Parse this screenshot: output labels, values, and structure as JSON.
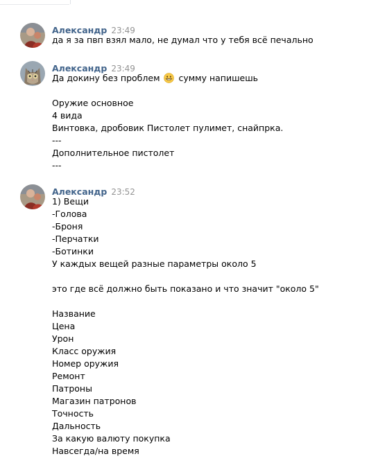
{
  "messages": [
    {
      "author": "Александр",
      "time": "23:49",
      "lines": [
        "да я за пвп взял мало, не думал что у тебя всё печально"
      ]
    },
    {
      "author": "Александр",
      "time": "23:49",
      "first_line": {
        "before": "Да докину без проблем",
        "emoji": "grinning-face-emoji",
        "after": "сумму напишешь"
      },
      "lines": [
        "",
        "Оружие основное",
        "4 вида",
        "Винтовка, дробовик Пистолет пулимет, снайпрка.",
        "---",
        "Дополнительное пистолет",
        "---"
      ]
    },
    {
      "author": "Александр",
      "time": "23:52",
      "lines": [
        "1) Вещи",
        "-Голова",
        "-Броня",
        "-Перчатки",
        "-Ботинки",
        "У каждых вещей разные параметры около 5",
        "",
        "это где всё должно быть показано и что значит \"около 5\"",
        "",
        "Название",
        "Цена",
        "Урон",
        "Класс оружия",
        "Номер оружия",
        "Ремонт",
        "Патроны",
        "Магазин патронов",
        "Точность",
        "Дальность",
        "За какую валюту покупка",
        "Навсегда/на время"
      ]
    }
  ],
  "colors": {
    "author": "#42648b",
    "time": "#939393",
    "text": "#000000",
    "background": "#ffffff"
  }
}
